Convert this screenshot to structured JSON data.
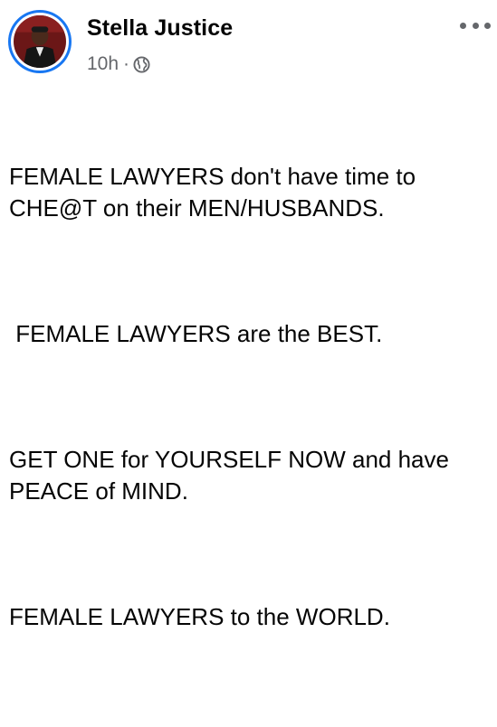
{
  "post": {
    "author": "Stella Justice",
    "time": "10h",
    "separator": "·",
    "audience_icon": "globe-icon",
    "more_icon": "more-options-icon",
    "paragraphs": [
      "FEMALE LAWYERS don't have time to\nCHE@T on their MEN/HUSBANDS.",
      " FEMALE LAWYERS are the BEST.",
      "GET ONE for YOURSELF NOW and have\nPEACE of MIND.",
      "FEMALE LAWYERS to the WORLD."
    ]
  },
  "colors": {
    "ring": "#1877f2",
    "text": "#050505",
    "secondary": "#65676b"
  }
}
